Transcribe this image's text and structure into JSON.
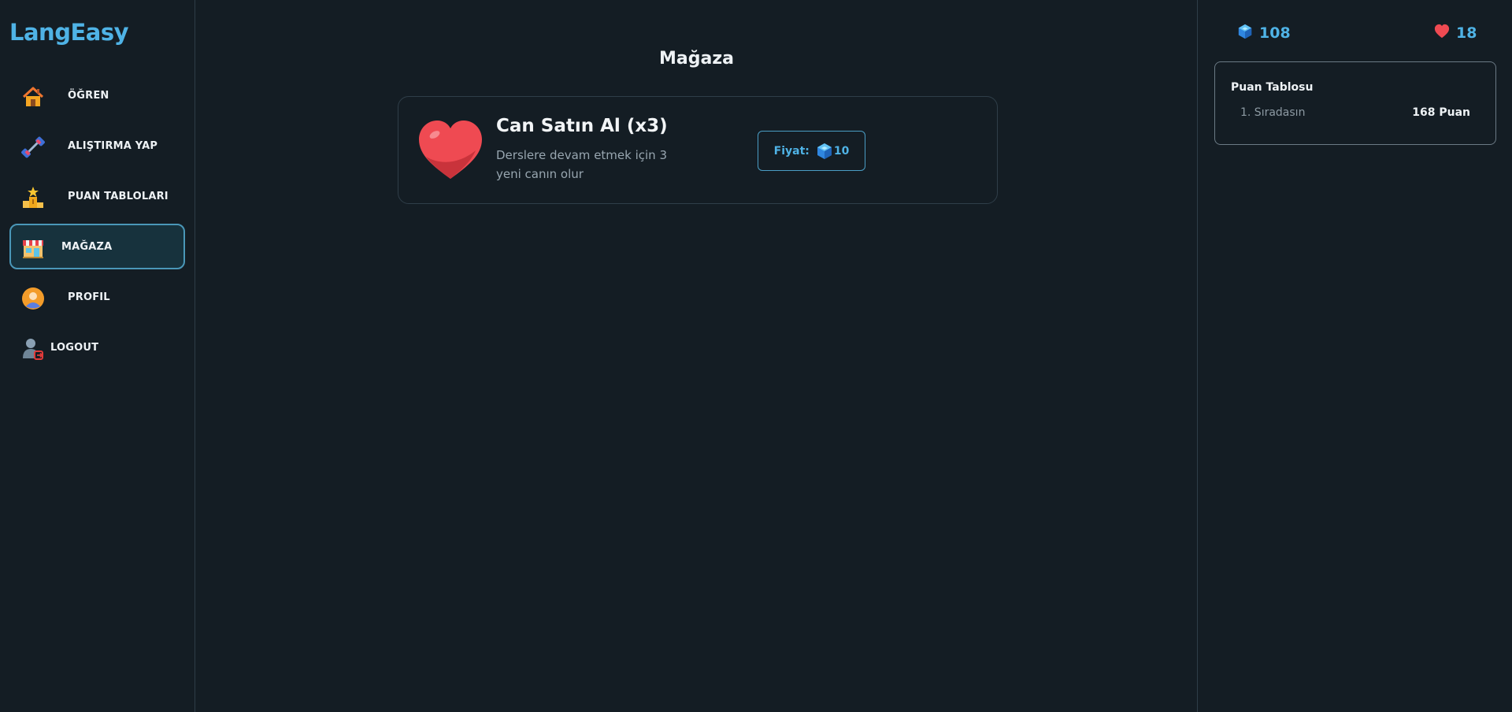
{
  "app": {
    "logo": "LangEasy"
  },
  "sidebar": {
    "items": [
      {
        "label": "ÖĞREN",
        "icon": "home-icon"
      },
      {
        "label": "ALIŞTIRMA YAP",
        "icon": "dumbbell-icon"
      },
      {
        "label": "PUAN TABLOLARI",
        "icon": "podium-icon"
      },
      {
        "label": "MAĞAZA",
        "icon": "store-icon",
        "active": true
      },
      {
        "label": "PROFIL",
        "icon": "profile-icon"
      },
      {
        "label": "LOGOUT",
        "icon": "logout-icon"
      }
    ]
  },
  "main": {
    "title": "Mağaza",
    "shop_item": {
      "icon": "heart-icon",
      "title": "Can Satın Al (x3)",
      "description": "Derslere devam etmek için 3 yeni canın olur",
      "price_label": "Fiyat:",
      "price_value": "10",
      "price_icon": "gem-icon"
    }
  },
  "stats": {
    "gems": "108",
    "hearts": "18"
  },
  "leaderboard": {
    "title": "Puan Tablosu",
    "rank": "1. Sıradasın",
    "points": "168 Puan"
  },
  "colors": {
    "background": "#141d24",
    "accent": "#4fb3e6",
    "active_nav_bg": "#17323d",
    "heart": "#ef4a52"
  }
}
